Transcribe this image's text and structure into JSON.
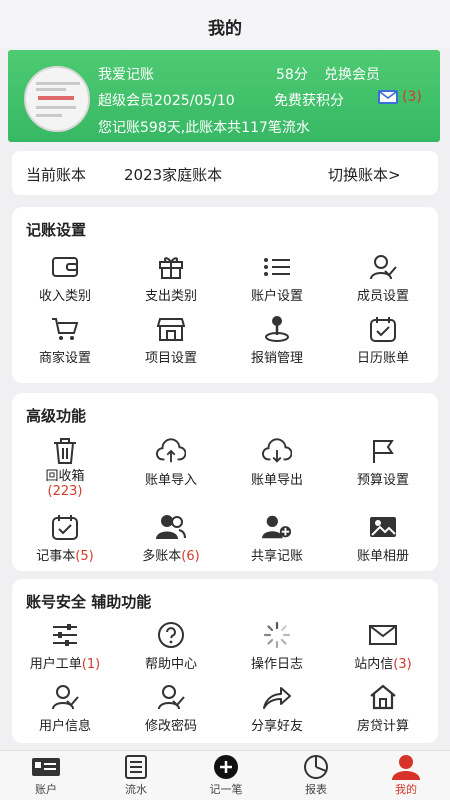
{
  "header": {
    "title": "我的"
  },
  "profile": {
    "nickname": "我爱记账",
    "points": "58分",
    "redeem_label": "兑换会员",
    "membership": "超级会员2025/05/10",
    "free_points_label": "免费获积分",
    "mail_count": "(3)",
    "summary": "您记账598天,此账本共117笔流水",
    "accent_color": "#3ec26b"
  },
  "current_book": {
    "label": "当前账本",
    "name": "2023家庭账本",
    "switch_label": "切换账本>"
  },
  "sections": [
    {
      "title": "记账设置",
      "items": [
        {
          "label": "收入类别",
          "icon": "wallet-icon"
        },
        {
          "label": "支出类别",
          "icon": "gift-icon"
        },
        {
          "label": "账户设置",
          "icon": "list-icon"
        },
        {
          "label": "成员设置",
          "icon": "user-check-icon"
        },
        {
          "label": "商家设置",
          "icon": "cart-icon"
        },
        {
          "label": "项目设置",
          "icon": "store-icon"
        },
        {
          "label": "报销管理",
          "icon": "joystick-icon"
        },
        {
          "label": "日历账单",
          "icon": "calendar-check-icon"
        }
      ]
    },
    {
      "title": "高级功能",
      "items": [
        {
          "label": "回收箱",
          "count": "(223)",
          "icon": "trash-icon"
        },
        {
          "label": "账单导入",
          "icon": "cloud-upload-icon"
        },
        {
          "label": "账单导出",
          "icon": "cloud-download-icon"
        },
        {
          "label": "预算设置",
          "icon": "flag-icon"
        },
        {
          "label": "记事本",
          "count": "(5)",
          "icon": "notebook-icon"
        },
        {
          "label": "多账本",
          "count": "(6)",
          "icon": "users-icon"
        },
        {
          "label": "共享记账",
          "icon": "user-add-icon"
        },
        {
          "label": "账单相册",
          "icon": "image-icon"
        }
      ]
    },
    {
      "title": "账号安全  辅助功能",
      "items": [
        {
          "label": "用户工单",
          "count": "(1)",
          "icon": "sliders-icon"
        },
        {
          "label": "帮助中心",
          "icon": "help-icon"
        },
        {
          "label": "操作日志",
          "icon": "loading-icon"
        },
        {
          "label": "站内信",
          "count": "(3)",
          "icon": "mail-icon"
        },
        {
          "label": "用户信息",
          "icon": "user-check-icon"
        },
        {
          "label": "修改密码",
          "icon": "user-check-icon"
        },
        {
          "label": "分享好友",
          "icon": "share-icon"
        },
        {
          "label": "房贷计算",
          "icon": "home-icon"
        }
      ]
    }
  ],
  "tabbar": [
    {
      "label": "账户",
      "icon": "id-card-icon"
    },
    {
      "label": "流水",
      "icon": "document-icon"
    },
    {
      "label": "记一笔",
      "icon": "plus-circle-icon"
    },
    {
      "label": "报表",
      "icon": "pie-chart-icon"
    },
    {
      "label": "我的",
      "icon": "user-icon",
      "active": true
    }
  ]
}
